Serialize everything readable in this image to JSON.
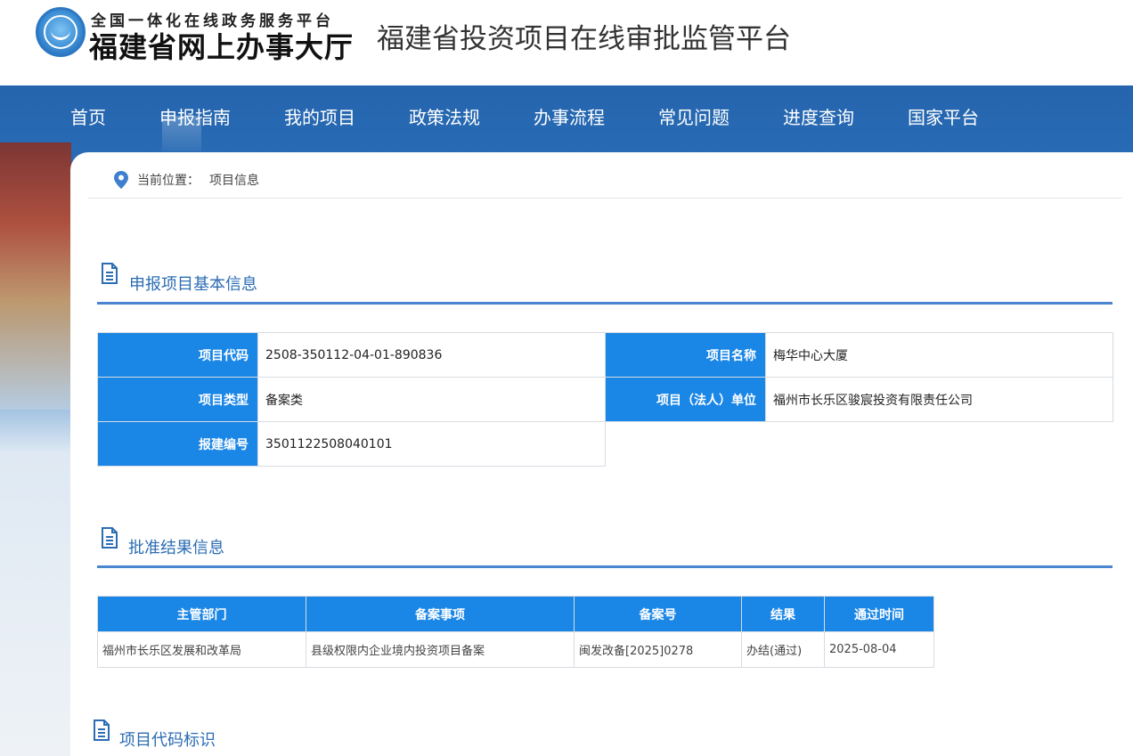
{
  "header": {
    "platform_line": "全国一体化在线政务服务平台",
    "hall_name": "福建省网上办事大厅",
    "site_title": "福建省投资项目在线审批监管平台"
  },
  "nav": {
    "items": [
      {
        "label": "首页"
      },
      {
        "label": "申报指南"
      },
      {
        "label": "我的项目"
      },
      {
        "label": "政策法规"
      },
      {
        "label": "办事流程"
      },
      {
        "label": "常见问题"
      },
      {
        "label": "进度查询"
      },
      {
        "label": "国家平台"
      }
    ]
  },
  "breadcrumb": {
    "label": "当前位置：",
    "current": "项目信息"
  },
  "basic_info": {
    "title": "申报项目基本信息",
    "fields": {
      "code_label": "项目代码",
      "code_value": "2508-350112-04-01-890836",
      "name_label": "项目名称",
      "name_value": "梅华中心大厦",
      "type_label": "项目类型",
      "type_value": "备案类",
      "unit_label": "项目（法人）单位",
      "unit_value": "福州市长乐区骏宸投资有限责任公司",
      "report_label": "报建编号",
      "report_value": "3501122508040101"
    }
  },
  "approval": {
    "title": "批准结果信息",
    "columns": [
      "主管部门",
      "备案事项",
      "备案号",
      "结果",
      "通过时间"
    ],
    "rows": [
      [
        "福州市长乐区发展和改革局",
        "县级权限内企业境内投资项目备案",
        "闽发改备[2025]0278",
        "办结(通过)",
        "2025-08-04"
      ]
    ]
  },
  "code_mark": {
    "title": "项目代码标识"
  },
  "colors": {
    "nav_bg": "#2565ae",
    "label_bg": "#1a86e6",
    "section_title": "#2b6cb3",
    "section_rule": "#4a86cf"
  }
}
